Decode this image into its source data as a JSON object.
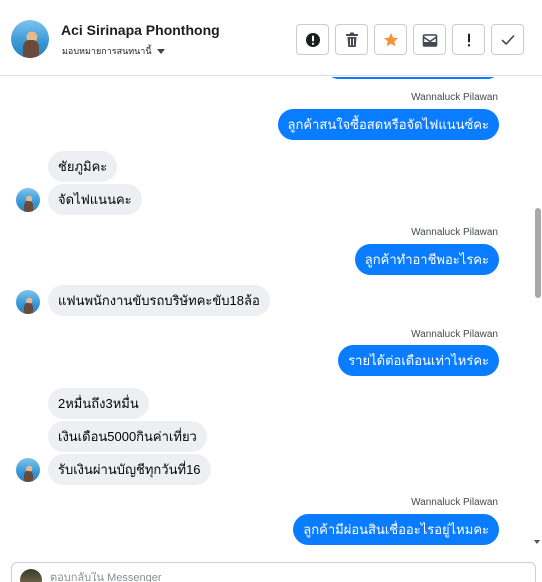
{
  "header": {
    "contact_name": "Aci Sirinapa Phonthong",
    "assign_label": "มอบหมายการสนทนานี้",
    "toolbar": [
      {
        "icon": "alert-circle-icon"
      },
      {
        "icon": "trash-icon"
      },
      {
        "icon": "star-icon"
      },
      {
        "icon": "mail-archive-icon"
      },
      {
        "icon": "exclamation-icon"
      },
      {
        "icon": "check-icon"
      }
    ]
  },
  "thread": {
    "messages": [
      {
        "id": 0,
        "direction": "out",
        "sender": "",
        "text": ""
      },
      {
        "id": 1,
        "direction": "out",
        "sender": "Wannaluck Pilawan",
        "text": "ลูกค้าสนใจซื้อสดหรือจัดไฟแนนซ์คะ"
      },
      {
        "id": 2,
        "direction": "in",
        "text": "ชัยภูมิคะ"
      },
      {
        "id": 3,
        "direction": "in",
        "text": "จัดไฟแนนคะ"
      },
      {
        "id": 4,
        "direction": "out",
        "sender": "Wannaluck Pilawan",
        "text": "ลูกค้าทำอาชีพอะไรคะ"
      },
      {
        "id": 5,
        "direction": "in",
        "text": "แฟนพนักงานขับรถบริษัทคะขับ18ล้อ"
      },
      {
        "id": 6,
        "direction": "out",
        "sender": "Wannaluck Pilawan",
        "text": "รายได้ต่อเดือนเท่าไหร่คะ"
      },
      {
        "id": 7,
        "direction": "in",
        "text": "2หมื่นถึง3หมื่น"
      },
      {
        "id": 8,
        "direction": "in",
        "text": "เงินเดือน5000กินค่าเที่ยว"
      },
      {
        "id": 9,
        "direction": "in",
        "text": "รับเงินผ่านบัญชีทุกวันที่16"
      },
      {
        "id": 10,
        "direction": "out",
        "sender": "Wannaluck Pilawan",
        "text": "ลูกค้ามีผ่อนสินเชื่ออะไรอยู่ไหมคะ"
      }
    ]
  },
  "composer": {
    "placeholder": "ตอบกลับใน Messenger",
    "value": ""
  },
  "colors": {
    "outgoing_bubble": "#0a7cff",
    "incoming_bubble": "#eeeff2",
    "star_accent": "#f7923b"
  }
}
